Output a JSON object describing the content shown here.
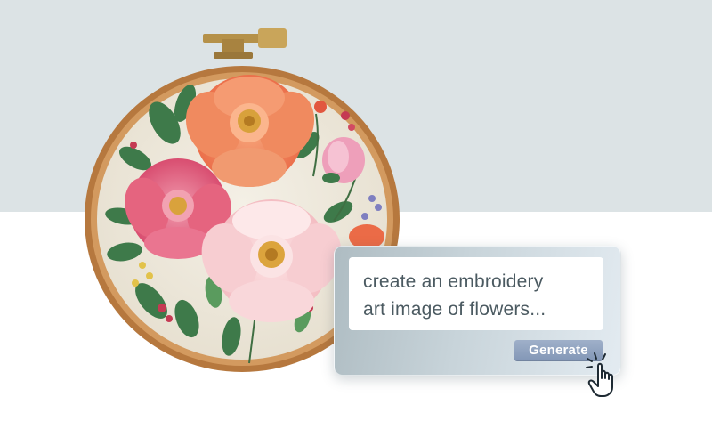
{
  "prompt": {
    "line1": "create an embroidery",
    "line2": "art image of flowers..."
  },
  "generate_label": "Generate",
  "icons": {
    "cursor": "hand-pointer-icon",
    "illustration": "embroidery-hoop-flowers"
  },
  "colors": {
    "band": "#dce3e5",
    "button": "#8c9fbd",
    "input_text": "#4b5a61"
  }
}
